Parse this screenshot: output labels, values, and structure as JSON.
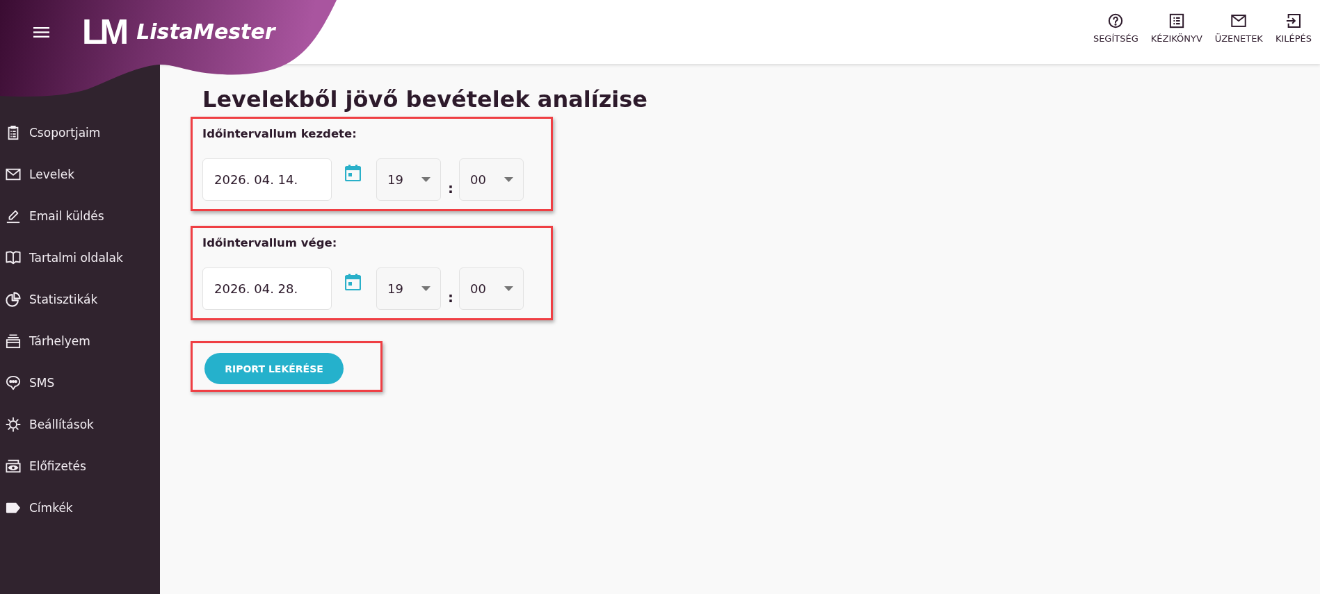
{
  "header": {
    "logo": {
      "mark": "LM",
      "name": "ListaMester"
    },
    "links": [
      {
        "label": "SEGÍTSÉG"
      },
      {
        "label": "KÉZIKÖNYV"
      },
      {
        "label": "ÜZENETEK"
      },
      {
        "label": "KILÉPÉS"
      }
    ]
  },
  "sidebar": {
    "items": [
      {
        "label": "Csoportjaim",
        "selected": false
      },
      {
        "label": "Levelek",
        "selected": false
      },
      {
        "label": "Email küldés",
        "selected": false
      },
      {
        "label": "Tartalmi oldalak",
        "selected": false
      },
      {
        "label": "Statisztikák",
        "selected": false
      },
      {
        "label": "Tárhelyem",
        "selected": false
      },
      {
        "label": "SMS",
        "selected": false
      },
      {
        "label": "Beállítások",
        "selected": false
      },
      {
        "label": "Előfizetés",
        "selected": false
      },
      {
        "label": "Címkék",
        "selected": false
      }
    ]
  },
  "page": {
    "title": "Levelekből jövő bevételek analízise",
    "sections": [
      {
        "label": "Időintervallum kezdete:",
        "highlighted": true,
        "date": "2026. 04. 14.",
        "hour": "19",
        "separator": ":",
        "minute": "00"
      },
      {
        "label": "Időintervallum vége:",
        "highlighted": true,
        "date": "2026. 04. 28.",
        "hour": "19",
        "separator": ":",
        "minute": "00"
      }
    ],
    "report_button": {
      "label": "RIPORT LEKÉRÉSE",
      "highlighted": true
    }
  }
}
